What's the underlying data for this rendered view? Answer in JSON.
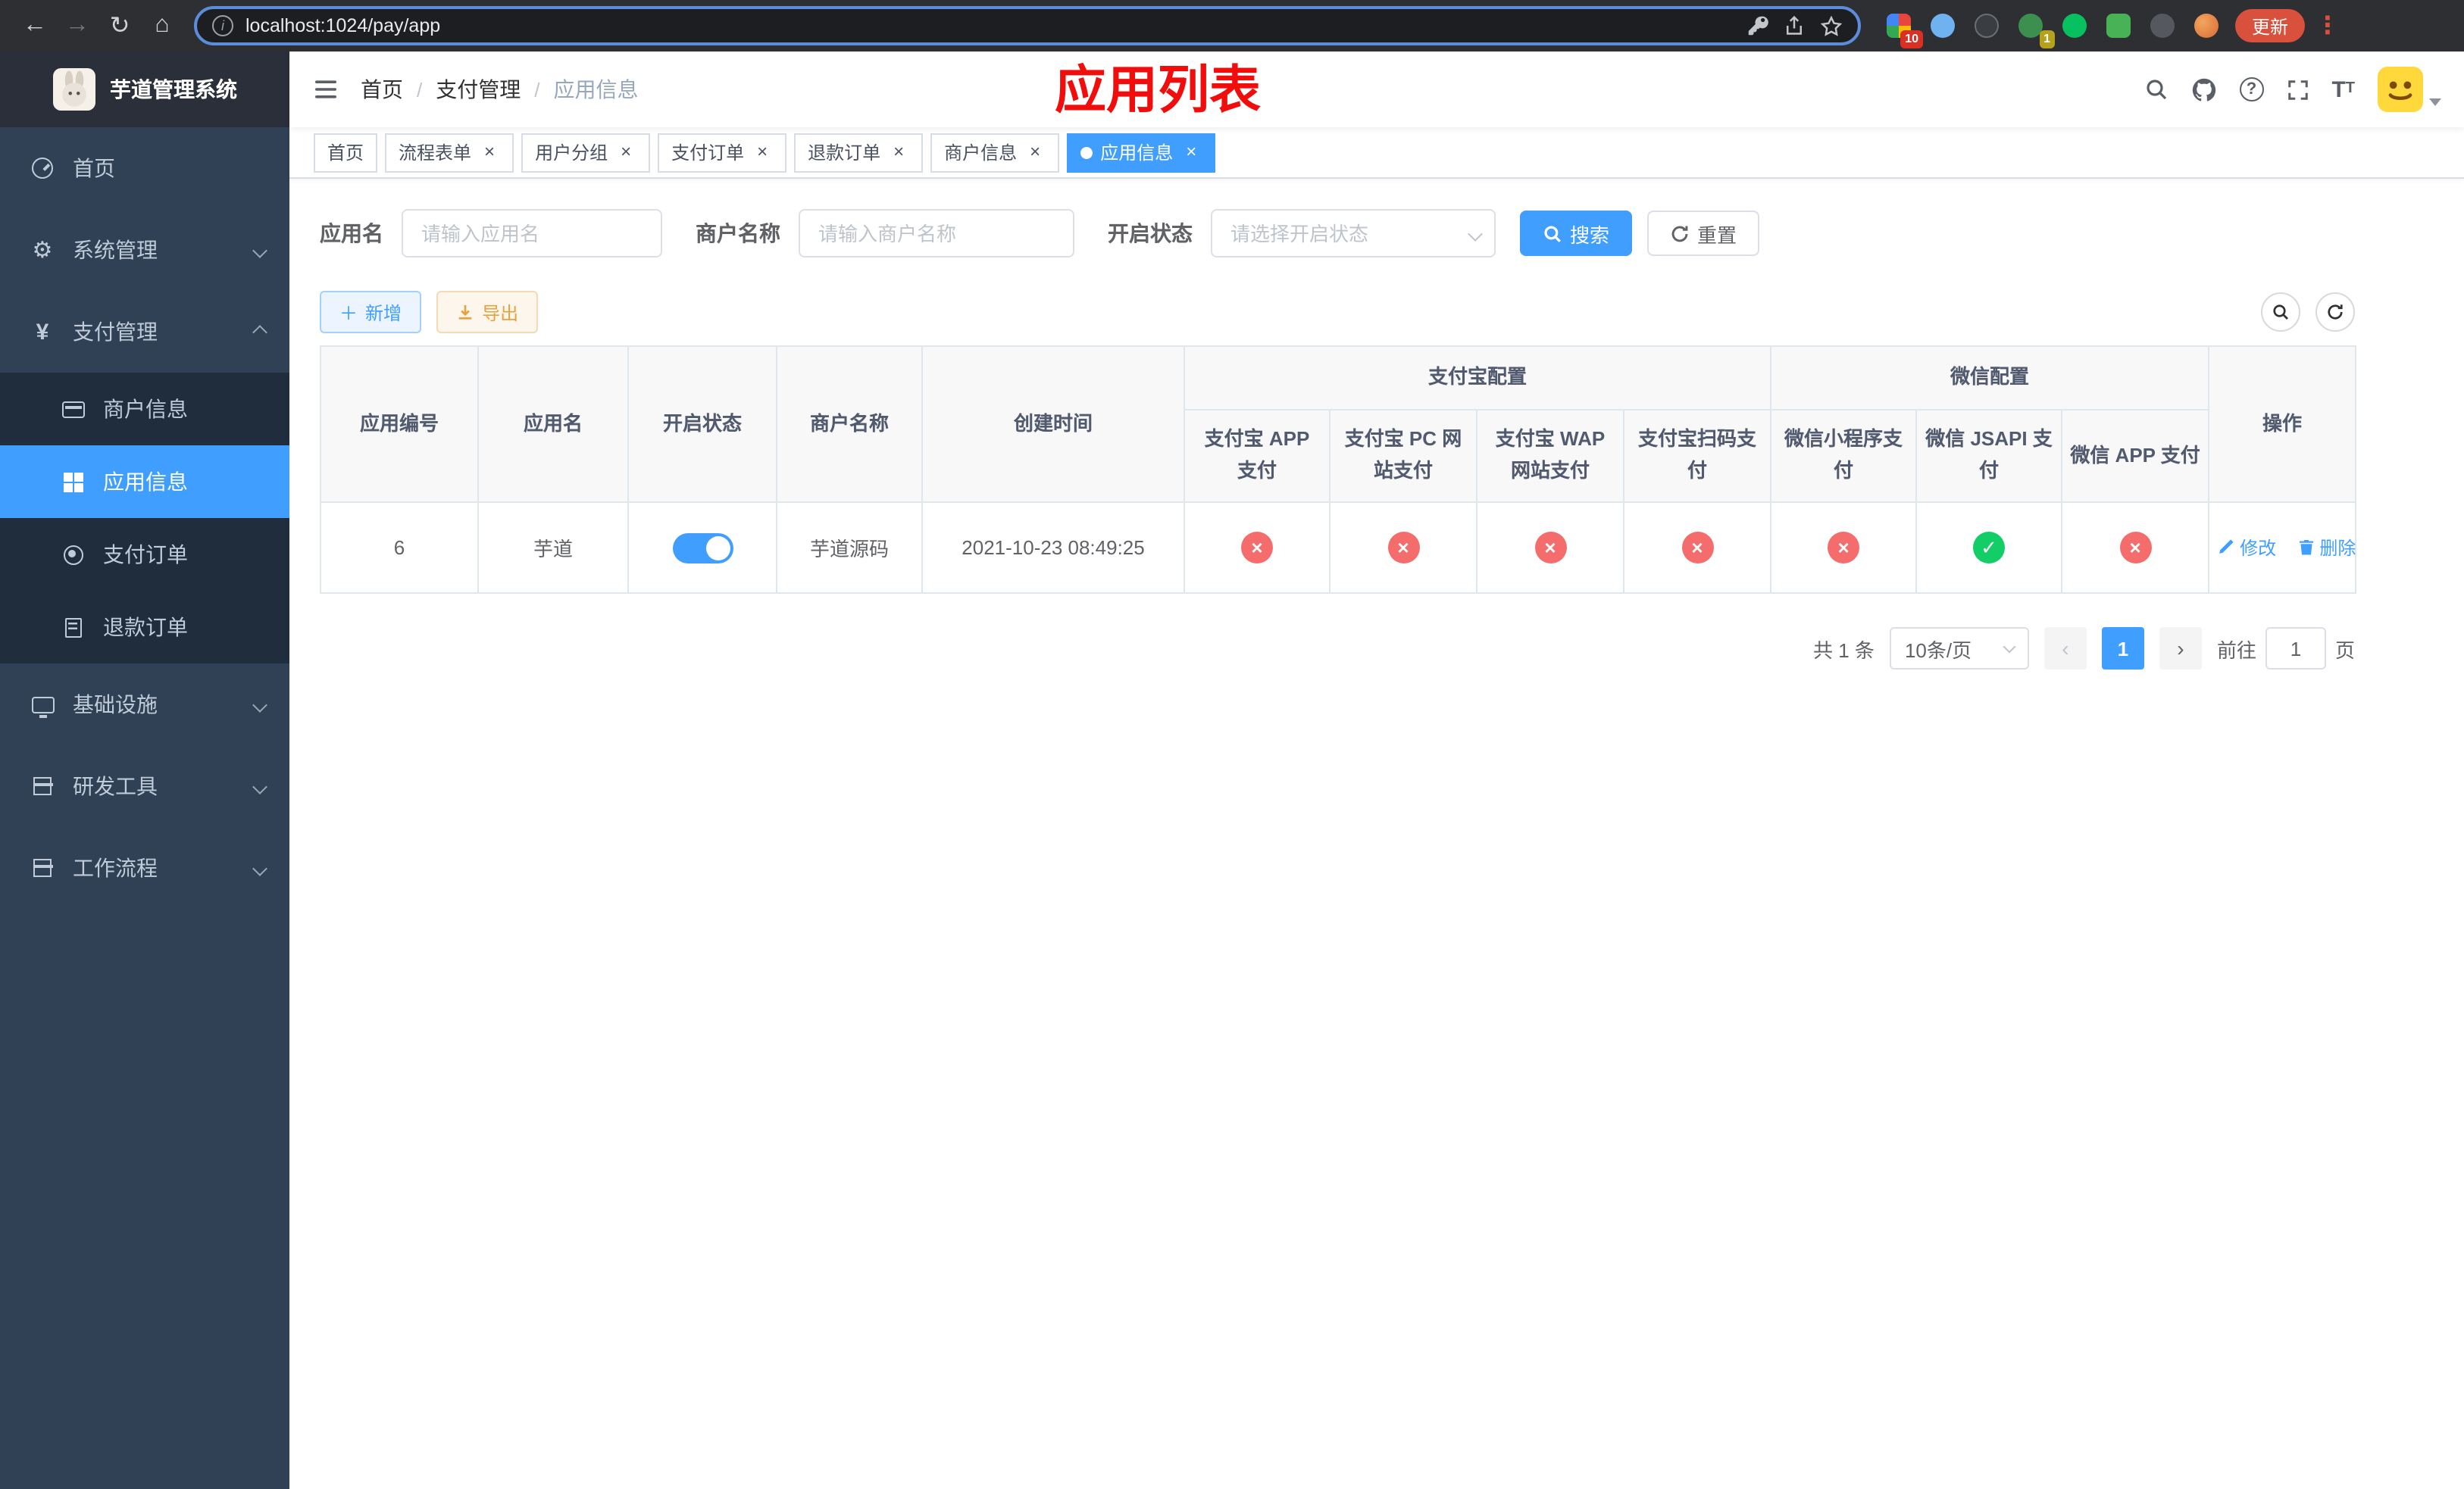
{
  "browser": {
    "url": "localhost:1024/pay/app",
    "update_label": "更新",
    "ext_badges": {
      "first": "10",
      "second": "1"
    },
    "nav_icons": [
      "back-icon",
      "forward-icon",
      "reload-icon",
      "home-icon"
    ],
    "omnibox_icons": [
      "info-icon",
      "key-icon",
      "share-icon",
      "star-icon"
    ]
  },
  "app": {
    "logo_title": "芋道管理系统",
    "overlay_title": "应用列表"
  },
  "sidebar": {
    "items": [
      {
        "label": "首页",
        "icon": "dashboard-icon"
      },
      {
        "label": "系统管理",
        "icon": "gear-icon"
      },
      {
        "label": "支付管理",
        "icon": "yen-icon"
      },
      {
        "label": "基础设施",
        "icon": "monitor-icon"
      },
      {
        "label": "研发工具",
        "icon": "toolbox-icon"
      },
      {
        "label": "工作流程",
        "icon": "workflow-icon"
      }
    ],
    "pay_children": [
      {
        "label": "商户信息",
        "icon": "card-icon"
      },
      {
        "label": "应用信息",
        "icon": "grid-icon"
      },
      {
        "label": "支付订单",
        "icon": "order-icon"
      },
      {
        "label": "退款订单",
        "icon": "refund-icon"
      }
    ]
  },
  "header_icons": [
    "search-icon",
    "github-icon",
    "question-icon",
    "fullscreen-icon",
    "font-size-icon",
    "avatar",
    "caret-down-icon"
  ],
  "breadcrumb": [
    "首页",
    "支付管理",
    "应用信息"
  ],
  "tags": [
    {
      "label": "首页"
    },
    {
      "label": "流程表单"
    },
    {
      "label": "用户分组"
    },
    {
      "label": "支付订单"
    },
    {
      "label": "退款订单"
    },
    {
      "label": "商户信息"
    },
    {
      "label": "应用信息"
    }
  ],
  "filters": {
    "app_name_label": "应用名",
    "app_name_placeholder": "请输入应用名",
    "merchant_label": "商户名称",
    "merchant_placeholder": "请输入商户名称",
    "status_label": "开启状态",
    "status_placeholder": "请选择开启状态",
    "search_label": "搜索",
    "reset_label": "重置"
  },
  "toolbar": {
    "add_label": "新增",
    "export_label": "导出"
  },
  "table": {
    "columns_left": [
      "应用编号",
      "应用名",
      "开启状态",
      "商户名称",
      "创建时间"
    ],
    "alipay_group_label": "支付宝配置",
    "alipay_columns": [
      "支付宝 APP 支付",
      "支付宝 PC 网站支付",
      "支付宝 WAP 网站支付",
      "支付宝扫码支付"
    ],
    "wechat_group_label": "微信配置",
    "wechat_columns": [
      "微信小程序支付",
      "微信 JSAPI 支付",
      "微信 APP 支付"
    ],
    "ops_label": "操作",
    "row": {
      "id": "6",
      "name": "芋道",
      "enabled": true,
      "merchant": "芋道源码",
      "created": "2021-10-23 08:49:25",
      "statuses": {
        "alipay_app": false,
        "alipay_pc": false,
        "alipay_wap": false,
        "alipay_qr": false,
        "wechat_mini": false,
        "wechat_jsapi": true,
        "wechat_app": false
      },
      "edit_label": "修改",
      "delete_label": "删除"
    }
  },
  "pagination": {
    "total_label": "共 1 条",
    "page_size_label": "10条/页",
    "current_page": "1",
    "goto_label": "前往",
    "goto_value": "1",
    "page_unit": "页"
  },
  "colors": {
    "primary": "#409EFF",
    "danger": "#f56c6c",
    "success": "#13ce66",
    "sidebar_bg": "#304156",
    "submenu_bg": "#1f2d3d",
    "title_red": "#f20d0d"
  }
}
